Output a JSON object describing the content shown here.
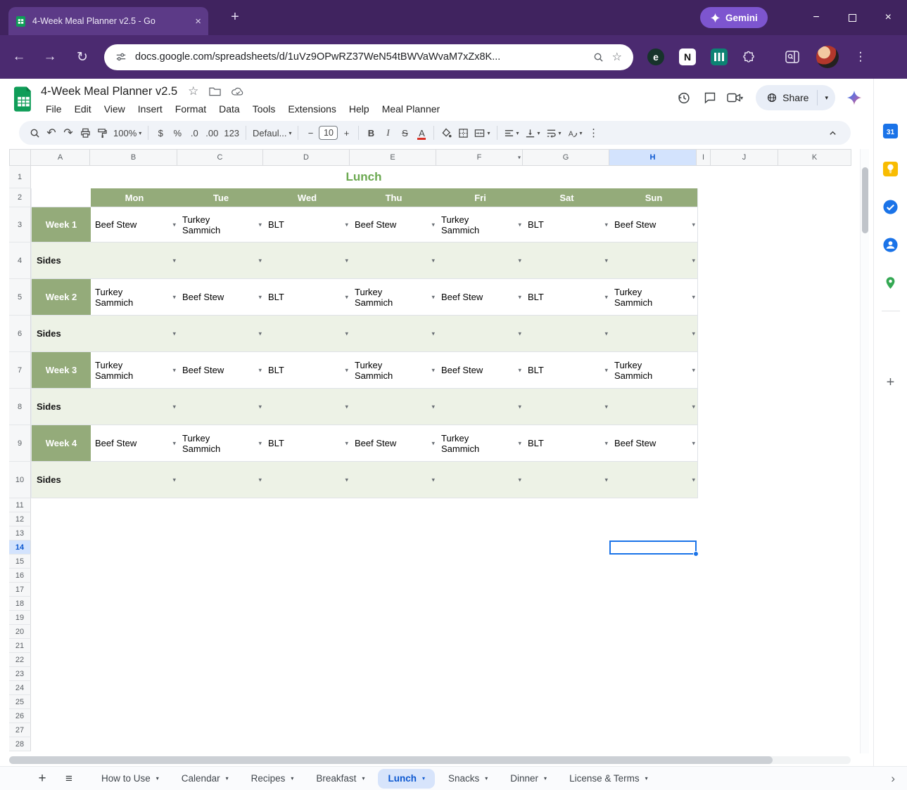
{
  "icons": {
    "dropdown": "▾",
    "undo": "↶",
    "redo": "↷",
    "back": "←",
    "forward": "→",
    "reload": "↻",
    "more_vertical": "⋮",
    "star_outline": "☆",
    "minimize": "−",
    "close": "×",
    "tab_close": "×",
    "new_tab": "+",
    "add": "+",
    "hamburger": "≡",
    "chevron_right": "›"
  },
  "browser": {
    "tab_title": "4-Week Meal Planner v2.5 - Go",
    "gemini_label": "Gemini",
    "url": "docs.google.com/spreadsheets/d/1uVz9OPwRZ37WeN54tBWVaWvaM7xZx8K...",
    "extensions": {
      "evernote_letter": "e",
      "notion_letter": "N"
    }
  },
  "app": {
    "title": "4-Week Meal Planner v2.5",
    "menus": [
      "File",
      "Edit",
      "View",
      "Insert",
      "Format",
      "Data",
      "Tools",
      "Extensions",
      "Help",
      "Meal Planner"
    ],
    "share_label": "Share"
  },
  "toolbar": {
    "zoom": "100%",
    "currency": "$",
    "percent": "%",
    "decimal_decrease": ".0",
    "decimal_increase": ".00",
    "number_format": "123",
    "font": "Defaul...",
    "minus": "−",
    "font_size": "10",
    "plus": "+",
    "bold": "B",
    "italic": "I",
    "strikethrough": "S",
    "text_color": "A"
  },
  "grid": {
    "columns": [
      "A",
      "B",
      "C",
      "D",
      "E",
      "F",
      "G",
      "H",
      "I",
      "J",
      "K"
    ],
    "selected_column": "H",
    "selected_row": 14,
    "visible_rows": 28,
    "planner": {
      "title": "Lunch",
      "days": [
        "Mon",
        "Tue",
        "Wed",
        "Thu",
        "Fri",
        "Sat",
        "Sun"
      ],
      "weeks": [
        {
          "label": "Week 1",
          "meals": [
            "Beef Stew",
            "Turkey Sammich",
            "BLT",
            "Beef Stew",
            "Turkey Sammich",
            "BLT",
            "Beef Stew"
          ]
        },
        {
          "label": "Week 2",
          "meals": [
            "Turkey Sammich",
            "Beef Stew",
            "BLT",
            "Turkey Sammich",
            "Beef Stew",
            "BLT",
            "Turkey Sammich"
          ]
        },
        {
          "label": "Week 3",
          "meals": [
            "Turkey Sammich",
            "Beef Stew",
            "BLT",
            "Turkey Sammich",
            "Beef Stew",
            "BLT",
            "Turkey Sammich"
          ]
        },
        {
          "label": "Week 4",
          "meals": [
            "Beef Stew",
            "Turkey Sammich",
            "BLT",
            "Beef Stew",
            "Turkey Sammich",
            "BLT",
            "Beef Stew"
          ]
        }
      ],
      "sides_label": "Sides"
    }
  },
  "sheet_tabs": [
    {
      "label": "How to Use",
      "active": false
    },
    {
      "label": "Calendar",
      "active": false
    },
    {
      "label": "Recipes",
      "active": false
    },
    {
      "label": "Breakfast",
      "active": false
    },
    {
      "label": "Lunch",
      "active": true
    },
    {
      "label": "Snacks",
      "active": false
    },
    {
      "label": "Dinner",
      "active": false
    },
    {
      "label": "License & Terms",
      "active": false
    }
  ],
  "side_rail": {
    "calendar_day": "31"
  },
  "colors": {
    "chrome_titlebar": "#40235f",
    "chrome_navbar": "#4b2a70",
    "chrome_tab": "#5c3a87",
    "gemini_pill": "#7d55cf",
    "sheets_green": "#0f9d58",
    "planner_header_green": "#94ab7a",
    "planner_sides_green": "#edf2e6",
    "planner_title_green": "#6aa84f",
    "selection_blue": "#1a73e8",
    "highlight_blue_bg": "#d3e3fd",
    "active_sheet_tab_text": "#0b57d0"
  }
}
